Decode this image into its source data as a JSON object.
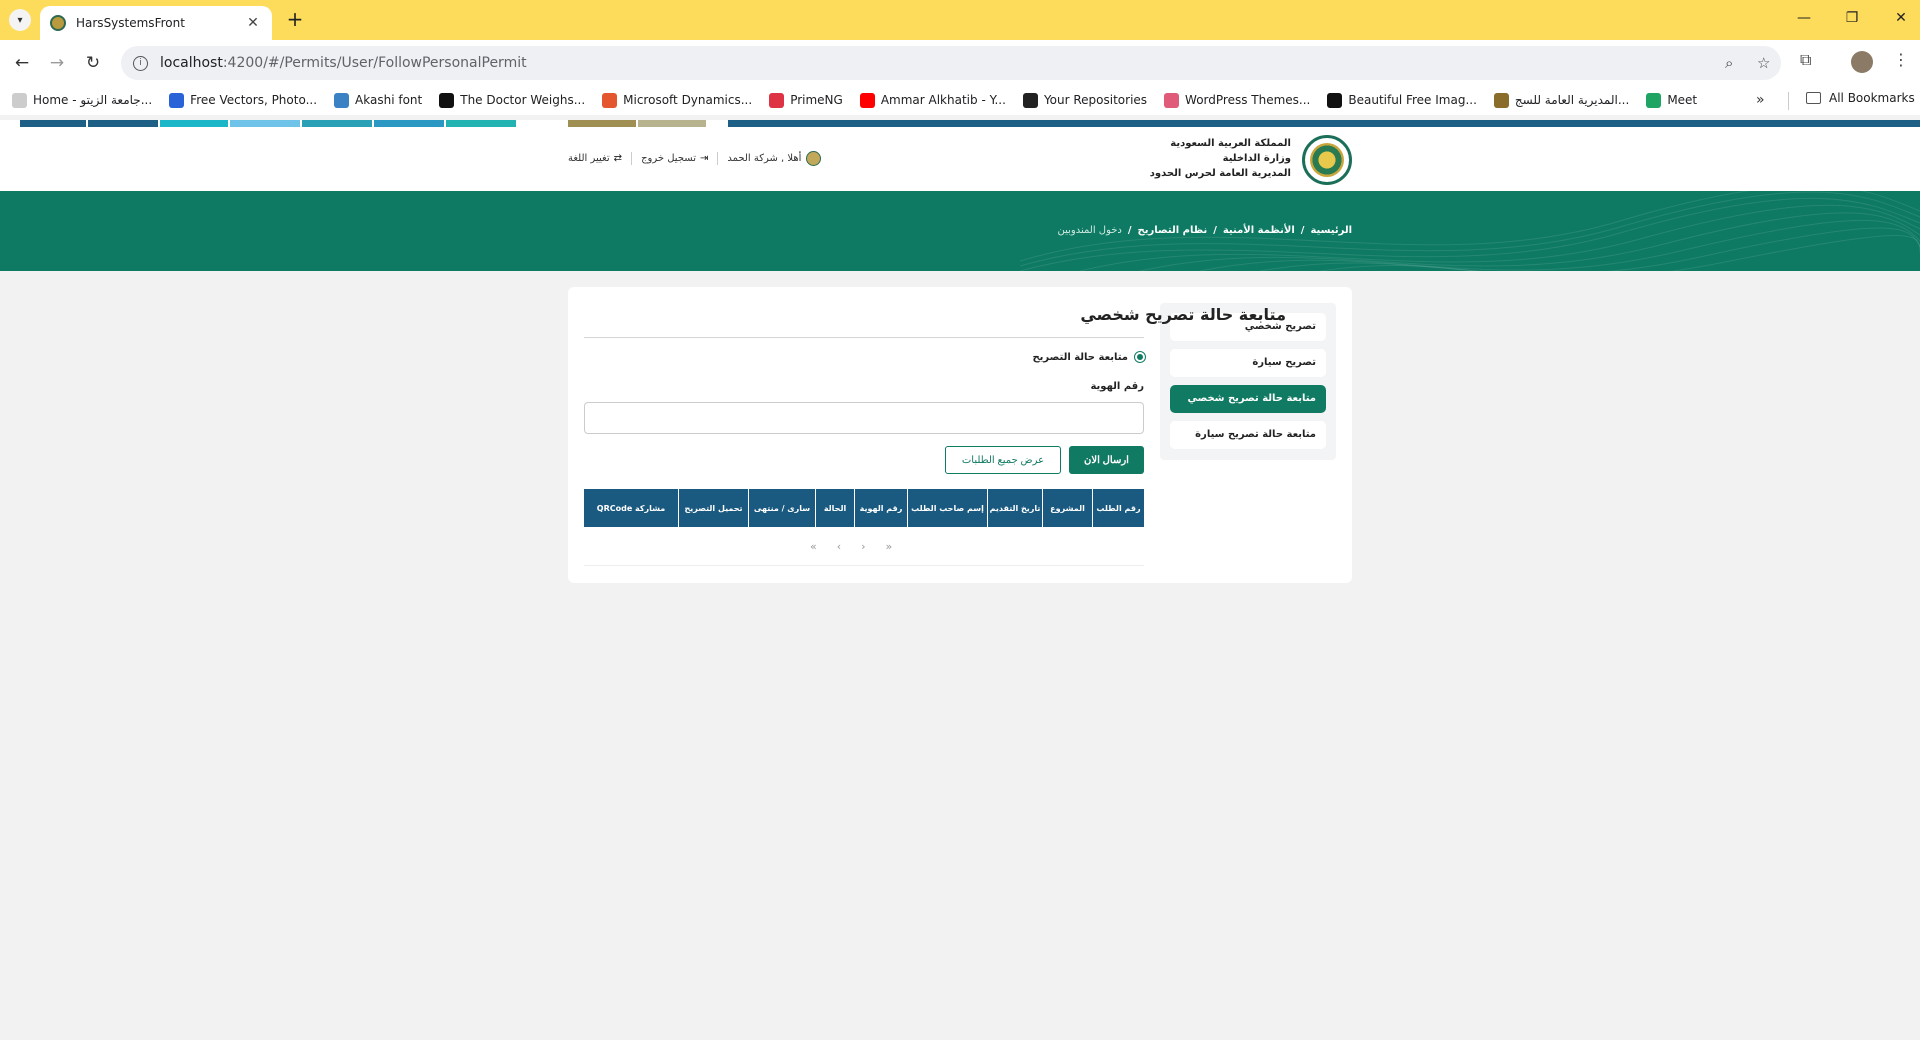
{
  "browser": {
    "tab_title": "HarsSystemsFront",
    "url_host": "localhost",
    "url_rest": ":4200/#/Permits/User/FollowPersonalPermit",
    "bookmarks": [
      {
        "label": "Home - جامعة الزيتو...",
        "color": "#cccccc"
      },
      {
        "label": "Free Vectors, Photo...",
        "color": "#2a63d8"
      },
      {
        "label": "Akashi font",
        "color": "#3b82c4"
      },
      {
        "label": "The Doctor Weighs...",
        "color": "#111111"
      },
      {
        "label": "Microsoft Dynamics...",
        "color": "#e4572e"
      },
      {
        "label": "PrimeNG",
        "color": "#dd3344"
      },
      {
        "label": "Ammar Alkhatib - Y...",
        "color": "#ff0000"
      },
      {
        "label": "Your Repositories",
        "color": "#222222"
      },
      {
        "label": "WordPress Themes...",
        "color": "#e05a7a"
      },
      {
        "label": "Beautiful Free Imag...",
        "color": "#111111"
      },
      {
        "label": "المديرية العامة للسج...",
        "color": "#8a6d2a"
      },
      {
        "label": "Meet",
        "color": "#1fa463"
      }
    ],
    "all_bookmarks": "All Bookmarks"
  },
  "header": {
    "org_line1": "المملكة العربية السعودية",
    "org_line2": "وزارة الداخلية",
    "org_line3": "المديرية العامة لحرس الحدود",
    "greeting": "أهلا , شركة الحمد",
    "logout": "تسجيل خروج",
    "change_lang": "تغيير اللغة"
  },
  "breadcrumb": {
    "home": "الرئيسية",
    "security": "الأنظمة الأمنية",
    "permits": "نظام التصاريح",
    "current": "دخول المندوبين"
  },
  "sidebar": {
    "items": [
      {
        "label": "تصريح شخصي",
        "active": false
      },
      {
        "label": "تصريح سيارة",
        "active": false
      },
      {
        "label": "متابعة حالة تصريح شخصي",
        "active": true
      },
      {
        "label": "متابعة حالة تصريح سيارة",
        "active": false
      }
    ]
  },
  "main": {
    "title": "متابعة حالة تصريح شخصي",
    "radio_label": "متابعة حالة التصريح",
    "id_label": "رقم الهوية",
    "id_value": "",
    "send_button": "ارسال الان",
    "view_all_button": "عرض جميع الطلبات",
    "columns": [
      "رقم الطلب",
      "المشروع",
      "تاريخ التقديم",
      "إسم صاحب الطلب",
      "رقم الهوية",
      "الحالة",
      "سارى / منتهى",
      "تحميل التصريح",
      "مشاركة QRCode"
    ],
    "pager": {
      "first": "«",
      "prev": "‹",
      "next": "›",
      "last": "»"
    }
  },
  "colors": {
    "accent": "#117a63",
    "table_header": "#1a5a80",
    "banner": "#0e7a63",
    "chrome_tabbar": "#fddc5c"
  }
}
